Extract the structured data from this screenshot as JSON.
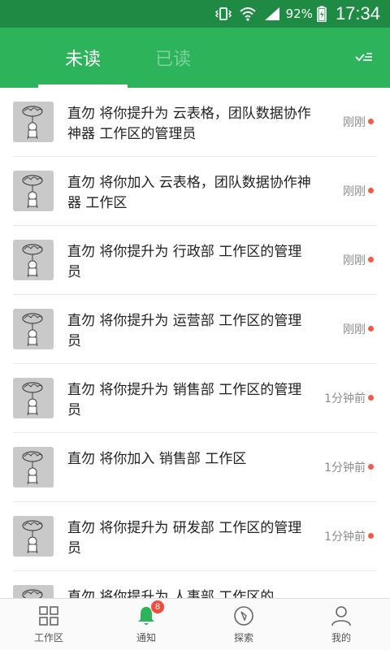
{
  "status_bar": {
    "battery_percent": "92%",
    "time": "17:34",
    "icons": [
      "vibrate-icon",
      "wifi-icon",
      "signal-icon",
      "battery-icon"
    ]
  },
  "header": {
    "tabs": [
      {
        "label": "未读",
        "selected": true
      },
      {
        "label": "已读",
        "selected": false
      }
    ],
    "action_icon": "mark-all-read-icon",
    "accent_color": "#2db35a"
  },
  "notifications": [
    {
      "message": "直勿 将你提升为 云表格，团队数据协作神器 工作区的管理员",
      "time": "刚刚",
      "unread": true
    },
    {
      "message": "直勿 将你加入 云表格，团队数据协作神器 工作区",
      "time": "刚刚",
      "unread": true
    },
    {
      "message": "直勿 将你提升为 行政部 工作区的管理员",
      "time": "刚刚",
      "unread": true
    },
    {
      "message": "直勿 将你提升为 运营部 工作区的管理员",
      "time": "刚刚",
      "unread": true
    },
    {
      "message": "直勿 将你提升为 销售部 工作区的管理员",
      "time": "1分钟前",
      "unread": true
    },
    {
      "message": "直勿 将你加入 销售部 工作区",
      "time": "1分钟前",
      "unread": true
    },
    {
      "message": "直勿 将你提升为 研发部 工作区的管理员",
      "time": "1分钟前",
      "unread": true
    },
    {
      "message": "直勿 将你提升为 人事部 工作区的",
      "time": "",
      "unread": true
    }
  ],
  "bottom_nav": {
    "items": [
      {
        "label": "工作区",
        "icon": "grid-icon"
      },
      {
        "label": "通知",
        "icon": "bell-icon",
        "badge": "8",
        "active": true
      },
      {
        "label": "探索",
        "icon": "compass-icon"
      },
      {
        "label": "我的",
        "icon": "user-icon"
      }
    ]
  }
}
